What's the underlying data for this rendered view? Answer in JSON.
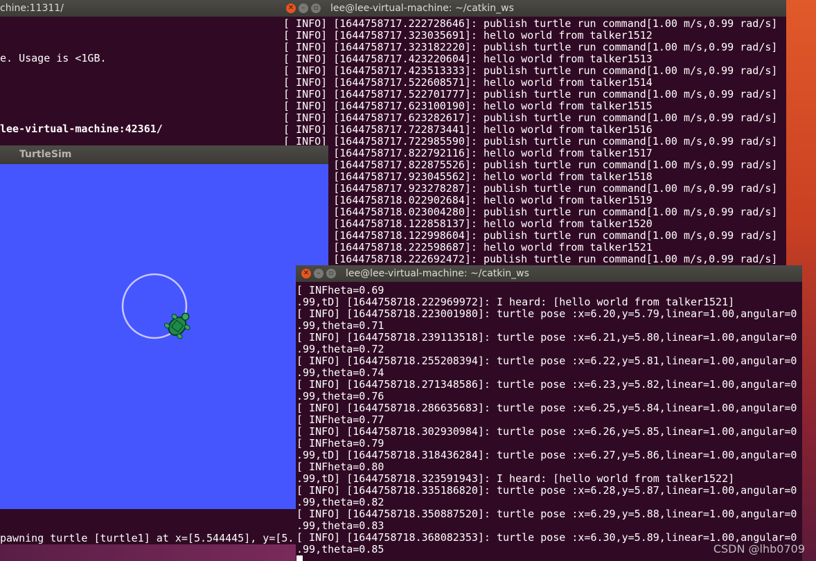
{
  "windows": {
    "roscore": {
      "title": "chine:11311/",
      "lines": [
        "e. Usage is <1GB.",
        "",
        "lee-virtual-machine:42361/"
      ]
    },
    "talker": {
      "title": "lee@lee-virtual-machine: ~/catkin_ws",
      "lines": [
        "[ INFO] [1644758717.222728646]: publish turtle run command[1.00 m/s,0.99 rad/s]",
        "[ INFO] [1644758717.323035691]: hello world from talker1512",
        "[ INFO] [1644758717.323182220]: publish turtle run command[1.00 m/s,0.99 rad/s]",
        "[ INFO] [1644758717.423220604]: hello world from talker1513",
        "[ INFO] [1644758717.423513333]: publish turtle run command[1.00 m/s,0.99 rad/s]",
        "[ INFO] [1644758717.522608571]: hello world from talker1514",
        "[ INFO] [1644758717.522701777]: publish turtle run command[1.00 m/s,0.99 rad/s]",
        "[ INFO] [1644758717.623100190]: hello world from talker1515",
        "[ INFO] [1644758717.623282617]: publish turtle run command[1.00 m/s,0.99 rad/s]",
        "[ INFO] [1644758717.722873441]: hello world from talker1516",
        "[ INFO] [1644758717.722985590]: publish turtle run command[1.00 m/s,0.99 rad/s]",
        "[ INFO] [1644758717.822792116]: hello world from talker1517",
        "[ INFO] [1644758717.822875526]: publish turtle run command[1.00 m/s,0.99 rad/s]",
        "[ INFO] [1644758717.923045562]: hello world from talker1518",
        "[ INFO] [1644758717.923278287]: publish turtle run command[1.00 m/s,0.99 rad/s]",
        "[ INFO] [1644758718.022902684]: hello world from talker1519",
        "[ INFO] [1644758718.023004280]: publish turtle run command[1.00 m/s,0.99 rad/s]",
        "[ INFO] [1644758718.122858137]: hello world from talker1520",
        "[ INFO] [1644758718.122998604]: publish turtle run command[1.00 m/s,0.99 rad/s]",
        "[ INFO] [1644758718.222598687]: hello world from talker1521",
        "[ INFO] [1644758718.222692472]: publish turtle run command[1.00 m/s,0.99 rad/s]"
      ]
    },
    "turtlesim": {
      "title": "TurtleSim",
      "spawn_text": "pawning turtle [turtle1] at x=[5.544445], y=[5."
    },
    "listener": {
      "title": "lee@lee-virtual-machine: ~/catkin_ws",
      "lines": [
        "[ INFheta=0.69",
        ".99,tD] [1644758718.222969972]: I heard: [hello world from talker1521]",
        "[ INFO] [1644758718.223001980]: turtle pose :x=6.20,y=5.79,linear=1.00,angular=0",
        ".99,theta=0.71",
        "[ INFO] [1644758718.239113518]: turtle pose :x=6.21,y=5.80,linear=1.00,angular=0",
        ".99,theta=0.72",
        "[ INFO] [1644758718.255208394]: turtle pose :x=6.22,y=5.81,linear=1.00,angular=0",
        ".99,theta=0.74",
        "[ INFO] [1644758718.271348586]: turtle pose :x=6.23,y=5.82,linear=1.00,angular=0",
        ".99,theta=0.76",
        "[ INFO] [1644758718.286635683]: turtle pose :x=6.25,y=5.84,linear=1.00,angular=0",
        "[ INFheta=0.77",
        "[ INFO] [1644758718.302930984]: turtle pose :x=6.26,y=5.85,linear=1.00,angular=0",
        "[ INFheta=0.79",
        ".99,tD] [1644758718.318436284]: turtle pose :x=6.27,y=5.86,linear=1.00,angular=0",
        "[ INFheta=0.80",
        ".99,tD] [1644758718.323591943]: I heard: [hello world from talker1522]",
        "[ INFO] [1644758718.335186820]: turtle pose :x=6.28,y=5.87,linear=1.00,angular=0",
        ".99,theta=0.82",
        "[ INFO] [1644758718.350887520]: turtle pose :x=6.29,y=5.88,linear=1.00,angular=0",
        ".99,theta=0.83",
        "[ INFO] [1644758718.368082353]: turtle pose :x=6.30,y=5.89,linear=1.00,angular=0",
        ".99,theta=0.85"
      ]
    }
  },
  "watermark": "CSDN @lhb0709",
  "colors": {
    "terminal_bg": "#300a24",
    "turtlesim_bg": "#4556ff",
    "trail": "#c8c8ff",
    "close_button": "#e9541f"
  }
}
